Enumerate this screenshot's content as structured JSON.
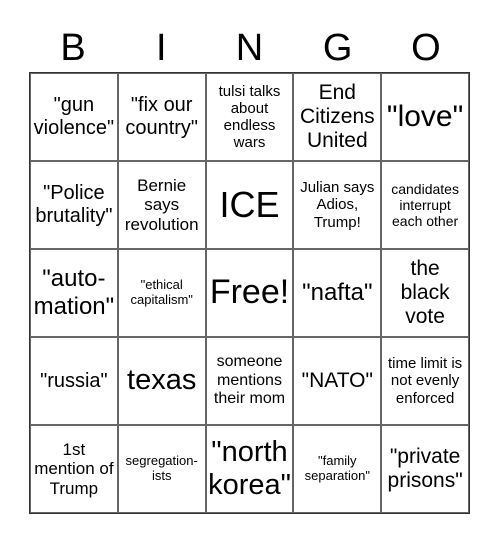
{
  "header": {
    "letters": [
      "B",
      "I",
      "N",
      "G",
      "O"
    ]
  },
  "cells": [
    [
      "\"gun violence\"",
      "\"fix our country\"",
      "tulsi talks about endless wars",
      "End Citizens United",
      "\"love\""
    ],
    [
      "\"Police brutality\"",
      "Bernie says revolution",
      "ICE",
      "Julian says Adios, Trump!",
      "candidates interrupt each other"
    ],
    [
      "\"auto-mation\"",
      "\"ethical capitalism\"",
      "Free!",
      "\"nafta\"",
      "the black vote"
    ],
    [
      "\"russia\"",
      "texas",
      "someone mentions their mom",
      "\"NATO\"",
      "time limit is not evenly enforced"
    ],
    [
      "1st mention of Trump",
      "segregation-ists",
      "\"north korea\"",
      "\"family separation\"",
      "\"private prisons\""
    ]
  ]
}
